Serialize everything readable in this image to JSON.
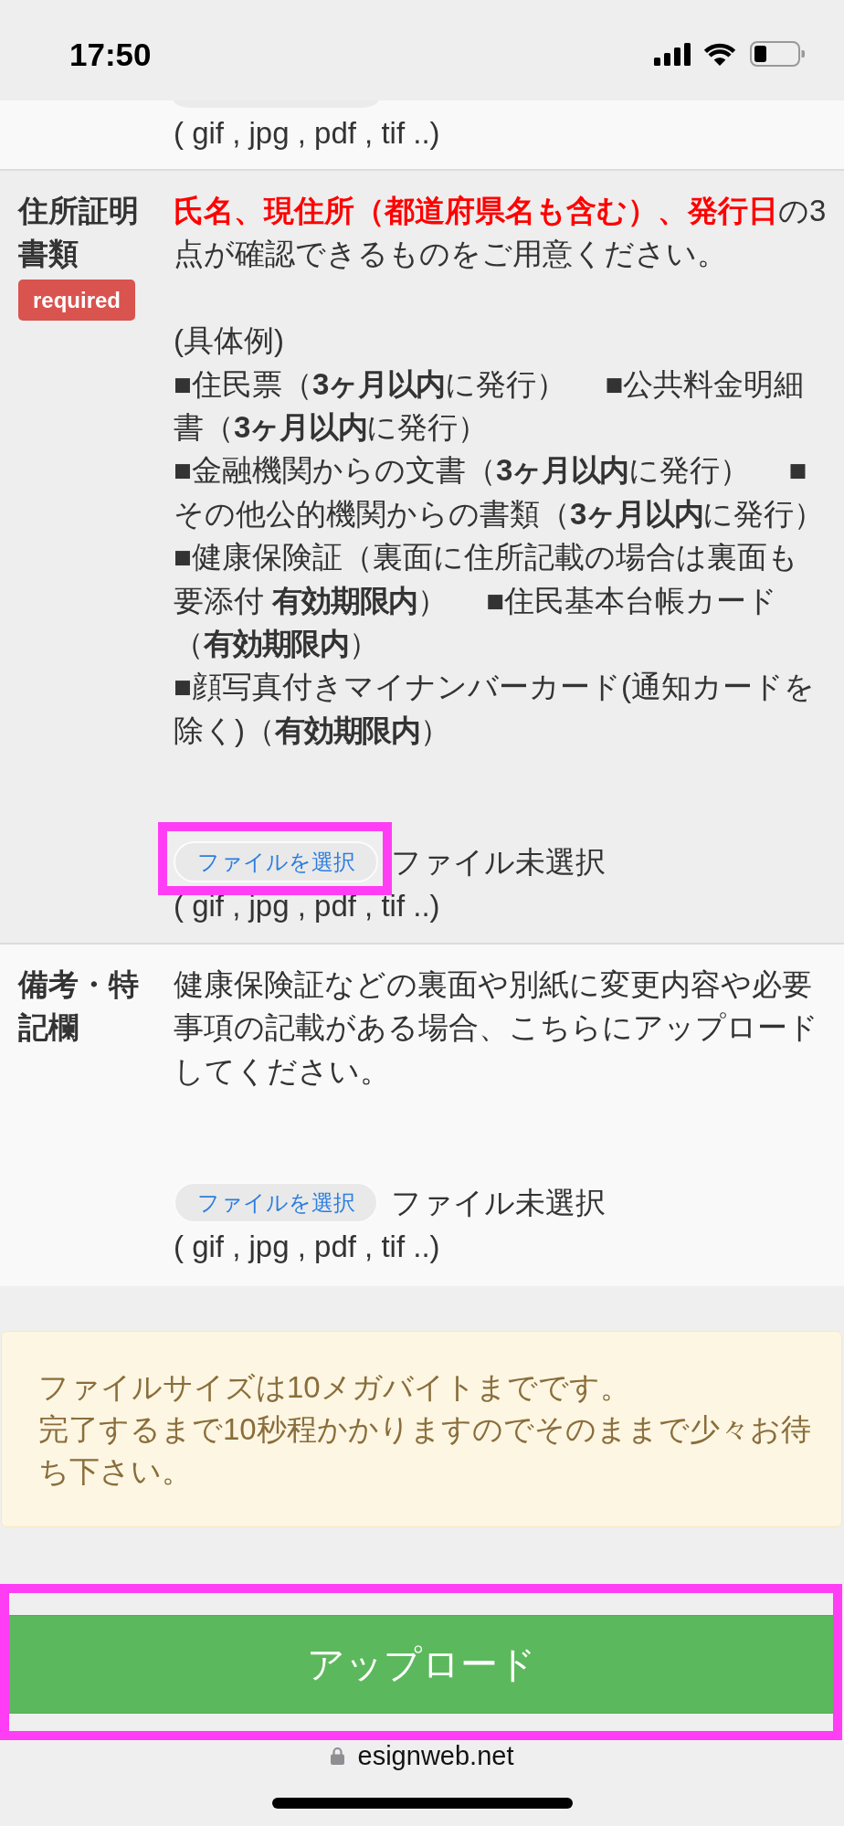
{
  "status_bar": {
    "time": "17:50"
  },
  "form_rows": [
    {
      "file_button": {
        "cut_off": true
      },
      "formats": "( gif , jpg , pdf , tif ..)"
    },
    {
      "label": "住所証明書類",
      "badge": "required",
      "intro": {
        "highlight": "氏名、現住所（都道府県名も含む）、発行日",
        "text": "の3点が確認できるものをご用意ください。"
      },
      "examples_heading": "(具体例)",
      "examples": [
        "■住民票（**3ヶ月以内**に発行）　 ■公共料金明細書（**3ヶ月以内**に発行）",
        "■金融機関からの文書（**3ヶ月以内**に発行）　 ■その他公的機関からの書類（**3ヶ月以内**に発行）",
        "■健康保険証（裏面に住所記載の場合は裏面も要添付 **有効期限内**）　 ■住民基本台帳カード（**有効期限内**）",
        "■顔写真付きマイナンバーカード(通知カードを除く)（**有効期限内**）"
      ],
      "file_button": {
        "label": "ファイルを選択",
        "cut_off": false,
        "highlighted": true
      },
      "file_status": "ファイル未選択",
      "formats": "( gif , jpg , pdf , tif ..)"
    },
    {
      "label": "備考・特記欄",
      "intro": {
        "text": "健康保険証などの裏面や別紙に変更内容や必要事項の記載がある場合、こちらにアップロードしてください。"
      },
      "file_button": {
        "label": "ファイルを選択",
        "cut_off": false,
        "highlighted": false
      },
      "file_status": "ファイル未選択",
      "formats": "( gif , jpg , pdf , tif ..)"
    }
  ],
  "notice": {
    "lines": [
      "ファイルサイズは10メガバイトまでです。",
      "完了するまで10秒程かかりますのでそのままで少々お待ち下さい。"
    ]
  },
  "upload_button": {
    "label": "アップロード",
    "highlighted": true
  },
  "browser": {
    "url": "esignweb.net"
  }
}
